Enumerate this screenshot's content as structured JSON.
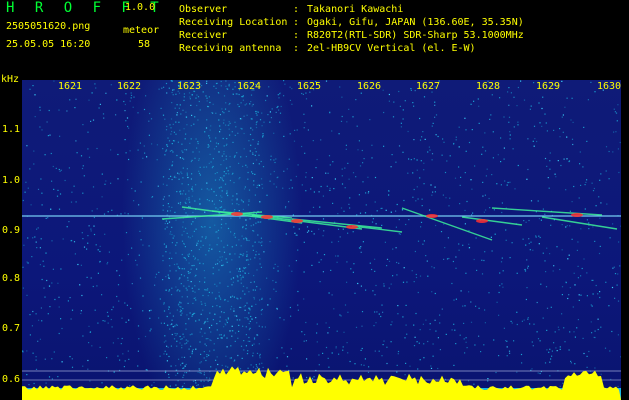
{
  "app": {
    "title": "H R O F F T",
    "version": "1.0.0"
  },
  "file": {
    "name": "2505051620.png",
    "datetime": "25.05.05 16:20",
    "mode": "meteor",
    "count": "58"
  },
  "info": [
    {
      "label": "Observer",
      "sep": ":",
      "value": "Takanori Kawachi"
    },
    {
      "label": "Receiving Location",
      "sep": ":",
      "value": "Ogaki, Gifu, JAPAN (136.60E, 35.35N)"
    },
    {
      "label": "Receiver",
      "sep": ":",
      "value": "R820T2(RTL-SDR) SDR-Sharp 53.1000MHz"
    },
    {
      "label": "Receiving antenna",
      "sep": ":",
      "value": "2el-HB9CV Vertical (el. E-W)"
    }
  ],
  "axis": {
    "unit": "kHz",
    "y_ticks": [
      "1.1",
      "1.0",
      "0.9",
      "0.8",
      "0.7",
      "0.6"
    ],
    "y_ticks_minor": [
      "1.05",
      "0.95",
      "0.85",
      "0.75",
      "0.65"
    ],
    "x_ticks": [
      "1621",
      "1622",
      "1623",
      "1624",
      "1625",
      "1626",
      "1627",
      "1628",
      "1629",
      "1630"
    ]
  },
  "colors": {
    "label": "#ffff00",
    "title": "#00ff33",
    "background": "#0d1877",
    "noise": "#1aa8d8",
    "carrier": "#7fe0ff",
    "echo": "#ff3030"
  }
}
